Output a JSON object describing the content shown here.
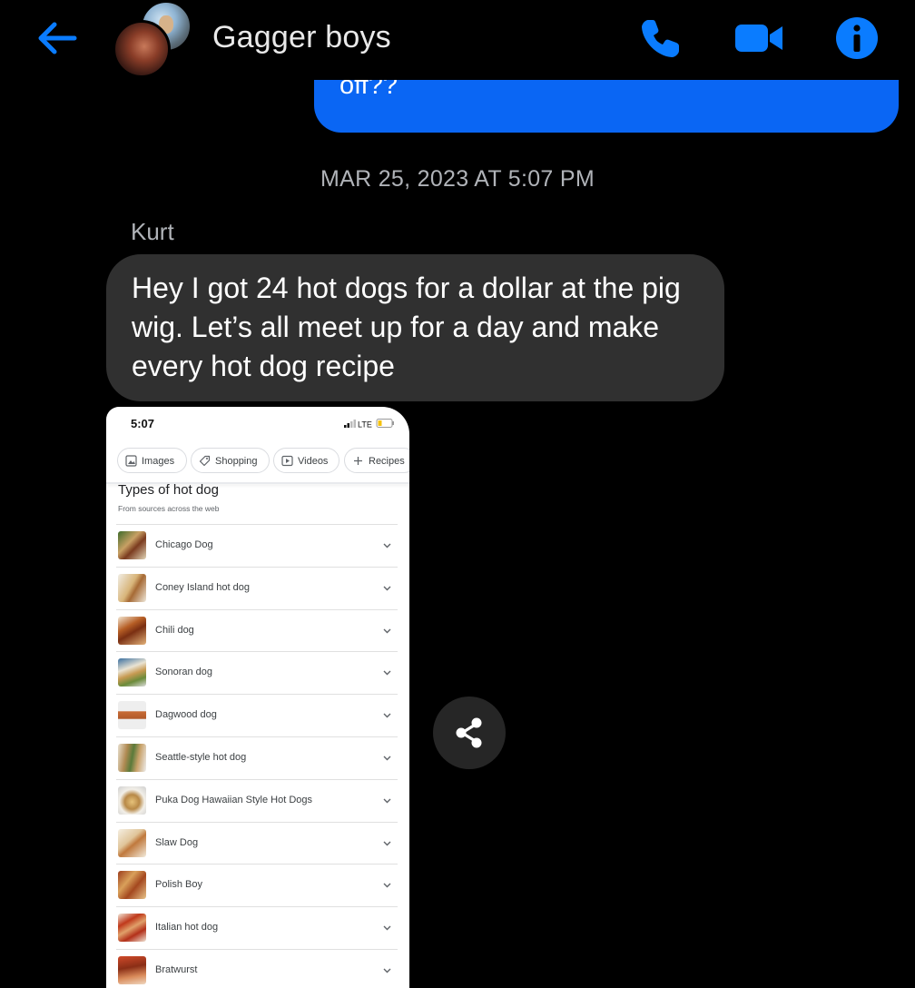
{
  "header": {
    "title": "Gagger boys",
    "icons": {
      "back": "back-arrow-icon",
      "call": "phone-icon",
      "video": "video-camera-icon",
      "info": "info-icon"
    },
    "accent_color": "#0a7cff"
  },
  "messages": {
    "sent_partial": "off??",
    "timestamp": "MAR 25, 2023 AT 5:07 PM",
    "sender_name": "Kurt",
    "received_text": "Hey I got 24 hot dogs for a dollar at the pig wig. Let’s all meet up for a day and make every hot dog recipe",
    "sent_bubble_color": "#0a66f4",
    "received_bubble_color": "#303030"
  },
  "screenshot": {
    "time": "5:07",
    "network": "LTE",
    "chips": [
      "Images",
      "Shopping",
      "Videos",
      "Recipes"
    ],
    "title": "Types of hot dog",
    "subtitle": "From sources across the web",
    "items": [
      "Chicago Dog",
      "Coney Island hot dog",
      "Chili dog",
      "Sonoran dog",
      "Dagwood dog",
      "Seattle-style hot dog",
      "Puka Dog Hawaiian Style Hot Dogs",
      "Slaw Dog",
      "Polish Boy",
      "Italian hot dog",
      "Bratwurst"
    ]
  },
  "share": {
    "icon": "share-icon"
  }
}
